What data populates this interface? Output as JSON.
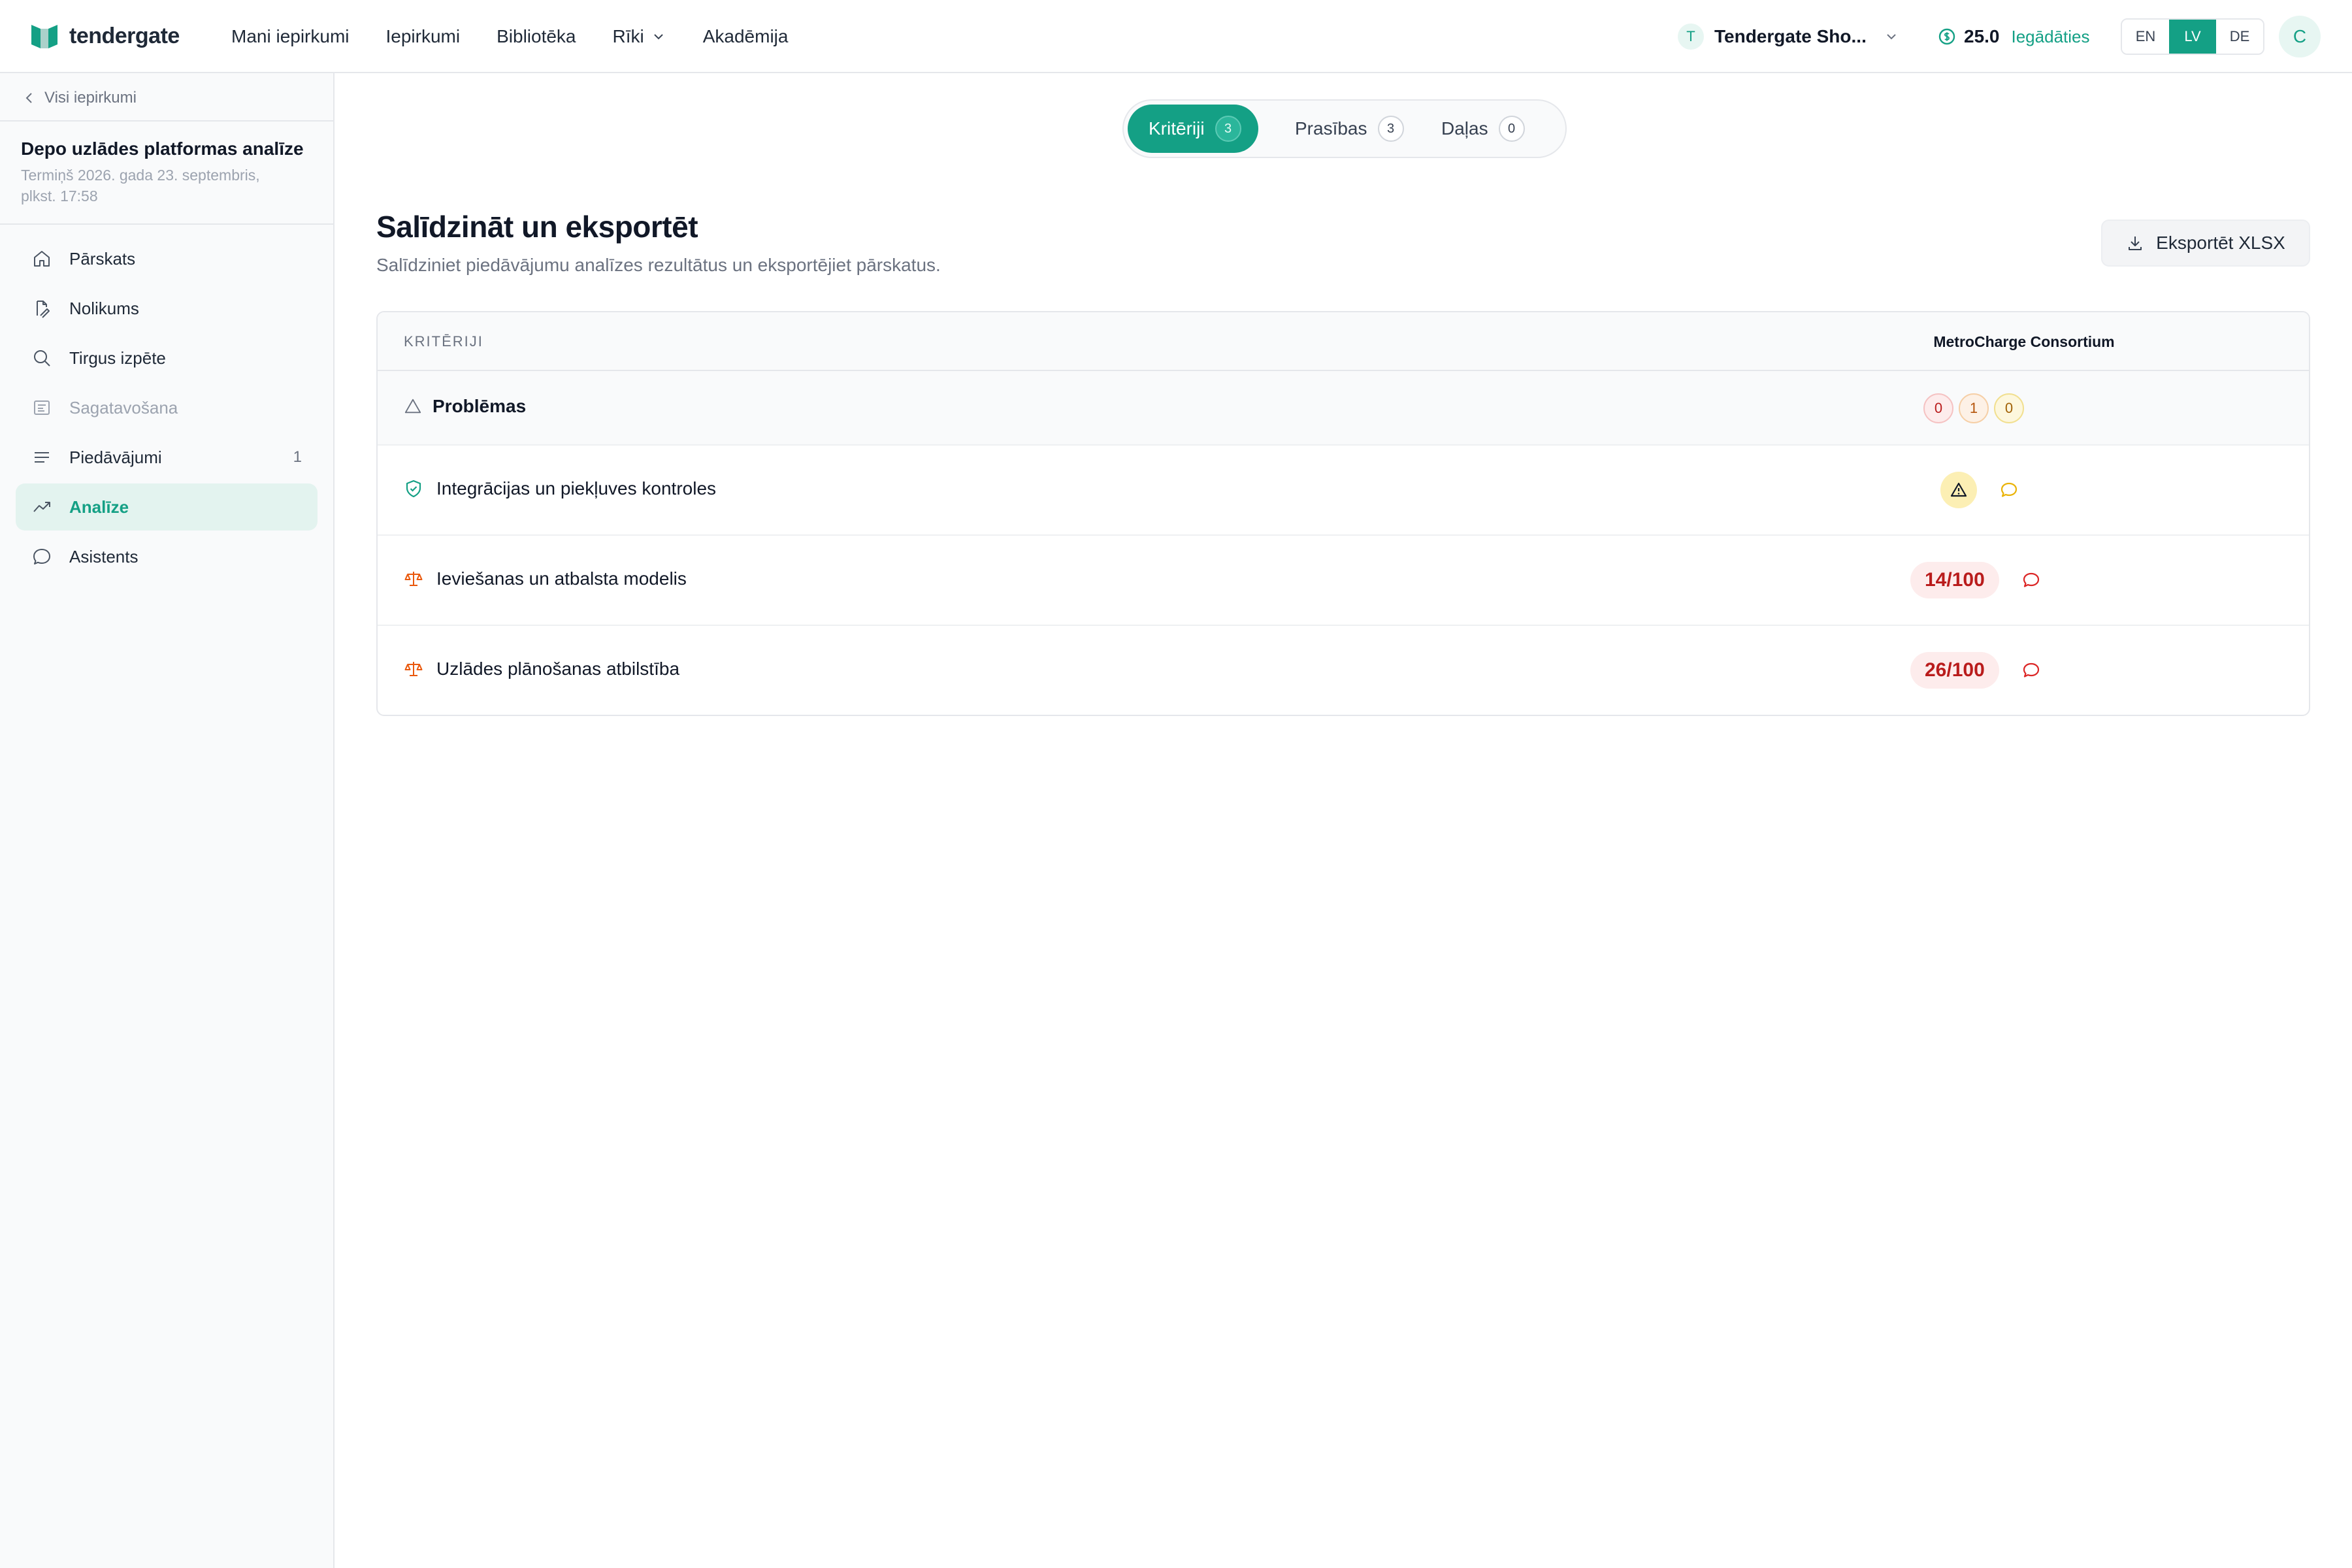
{
  "topbar": {
    "brand": "tendergate",
    "nav": [
      {
        "label": "Mani iepirkumi"
      },
      {
        "label": "Iepirkumi"
      },
      {
        "label": "Bibliotēka"
      },
      {
        "label": "Rīki"
      },
      {
        "label": "Akadēmija"
      }
    ],
    "org_initial": "T",
    "org_name": "Tendergate Sho...",
    "credits": "25.0",
    "credits_link": "Iegādāties",
    "languages": [
      "EN",
      "LV",
      "DE"
    ],
    "active_language": "LV",
    "avatar_initial": "C"
  },
  "sidebar": {
    "back_label": "Visi iepirkumi",
    "project_title": "Depo uzlādes platformas analīze",
    "project_deadline_line1": "Termiņš 2026. gada 23. septembris,",
    "project_deadline_line2": "plkst. 17:58",
    "items": [
      {
        "label": "Pārskats",
        "icon": "home-icon"
      },
      {
        "label": "Nolikums",
        "icon": "file-icon"
      },
      {
        "label": "Tirgus izpēte",
        "icon": "search-icon"
      },
      {
        "label": "Sagatavošana",
        "icon": "document-icon"
      },
      {
        "label": "Piedāvājumi",
        "icon": "list-icon",
        "count": "1"
      },
      {
        "label": "Analīze",
        "icon": "trend-icon"
      },
      {
        "label": "Asistents",
        "icon": "chat-icon"
      }
    ]
  },
  "tabs": [
    {
      "label": "Kritēriji",
      "count": "3"
    },
    {
      "label": "Prasības",
      "count": "3"
    },
    {
      "label": "Daļas",
      "count": "0"
    }
  ],
  "main": {
    "title": "Salīdzināt un eksportēt",
    "subtitle": "Salīdziniet piedāvājumu analīzes rezultātus un eksportējiet pārskatus.",
    "export_label": "Eksportēt XLSX"
  },
  "table": {
    "col_criteria": "KRITĒRIJI",
    "col_vendor": "MetroCharge Consortium",
    "problems": {
      "label": "Problēmas",
      "counts": [
        "0",
        "1",
        "0"
      ],
      "colors": [
        "#b91c1c",
        "#b45309",
        "#a16207"
      ]
    },
    "rows": [
      {
        "label": "Integrācijas un piekļuves kontroles",
        "icon": "shield-icon",
        "value": "warning"
      },
      {
        "label": "Ieviešanas un atbalsta modelis",
        "icon": "scale-icon",
        "value": "14/100"
      },
      {
        "label": "Uzlādes plānošanas atbilstība",
        "icon": "scale-icon",
        "value": "26/100"
      }
    ]
  },
  "colors": {
    "accent": "#14a085",
    "danger": "#b91c1c",
    "warning": "#eab308"
  }
}
